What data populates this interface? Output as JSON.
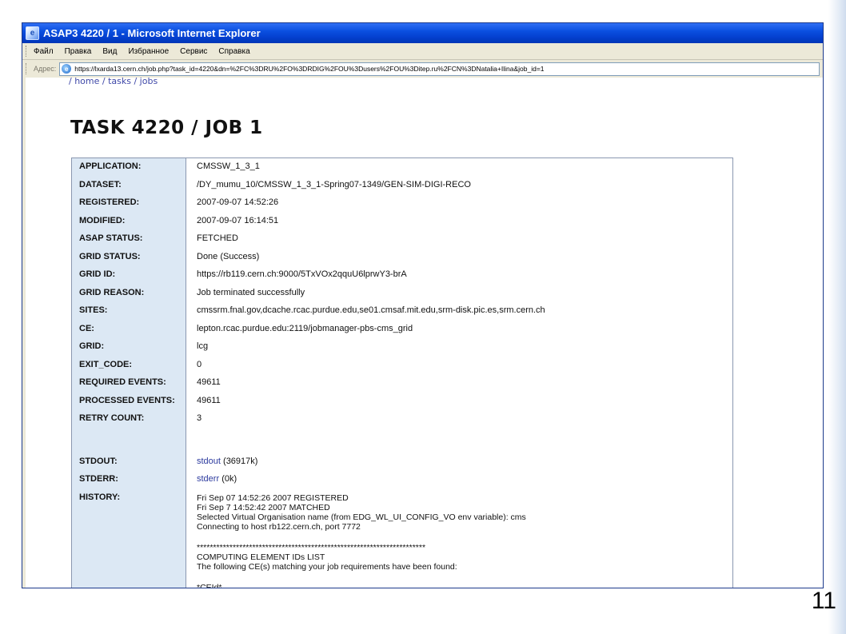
{
  "window": {
    "title": "ASAP3 4220 / 1 - Microsoft Internet Explorer",
    "menu": [
      "Файл",
      "Правка",
      "Вид",
      "Избранное",
      "Сервис",
      "Справка"
    ],
    "address_label": "Адрес:",
    "url": "https://lxarda13.cern.ch/job.php?task_id=4220&dn=%2FC%3DRU%2FO%3DRDIG%2FOU%3Dusers%2FOU%3Ditep.ru%2FCN%3DNatalia+Ilina&job_id=1"
  },
  "page": {
    "breadcrumb": "/ home / tasks / jobs",
    "title": "TASK 4220 / JOB 1"
  },
  "fields": [
    {
      "label": "APPLICATION:",
      "value": "CMSSW_1_3_1"
    },
    {
      "label": "DATASET:",
      "value": "/DY_mumu_10/CMSSW_1_3_1-Spring07-1349/GEN-SIM-DIGI-RECO"
    },
    {
      "label": "REGISTERED:",
      "value": "2007-09-07 14:52:26"
    },
    {
      "label": "MODIFIED:",
      "value": "2007-09-07 16:14:51"
    },
    {
      "label": "ASAP STATUS:",
      "value": "FETCHED"
    },
    {
      "label": "GRID STATUS:",
      "value": "Done (Success)"
    },
    {
      "label": "GRID ID:",
      "value": "https://rb119.cern.ch:9000/5TxVOx2qquU6lprwY3-brA"
    },
    {
      "label": "GRID REASON:",
      "value": "Job terminated successfully"
    },
    {
      "label": "SITES:",
      "value": "cmssrm.fnal.gov,dcache.rcac.purdue.edu,se01.cmsaf.mit.edu,srm-disk.pic.es,srm.cern.ch"
    },
    {
      "label": "CE:",
      "value": "lepton.rcac.purdue.edu:2119/jobmanager-pbs-cms_grid"
    },
    {
      "label": "GRID:",
      "value": "lcg"
    },
    {
      "label": "EXIT_CODE:",
      "value": "0"
    },
    {
      "label": "REQUIRED EVENTS:",
      "value": "49611"
    },
    {
      "label": "PROCESSED EVENTS:",
      "value": "49611"
    },
    {
      "label": "RETRY COUNT:",
      "value": "3"
    }
  ],
  "stdout": {
    "label": "STDOUT:",
    "link": "stdout",
    "size": "(36917k)"
  },
  "stderr": {
    "label": "STDERR:",
    "link": "stderr",
    "size": "(0k)"
  },
  "history": {
    "label": "HISTORY:",
    "lines": [
      "Fri Sep 07 14:52:26 2007 REGISTERED",
      "Fri Sep 7 14:52:42 2007 MATCHED",
      "Selected Virtual Organisation name (from EDG_WL_UI_CONFIG_VO env variable): cms",
      "Connecting to host rb122.cern.ch, port 7772",
      "",
      "**********************************************************************",
      "COMPUTING ELEMENT IDs LIST",
      "The following CE(s) matching your job requirements have been found:",
      "",
      "*CEId*"
    ]
  },
  "slide_number": "11"
}
